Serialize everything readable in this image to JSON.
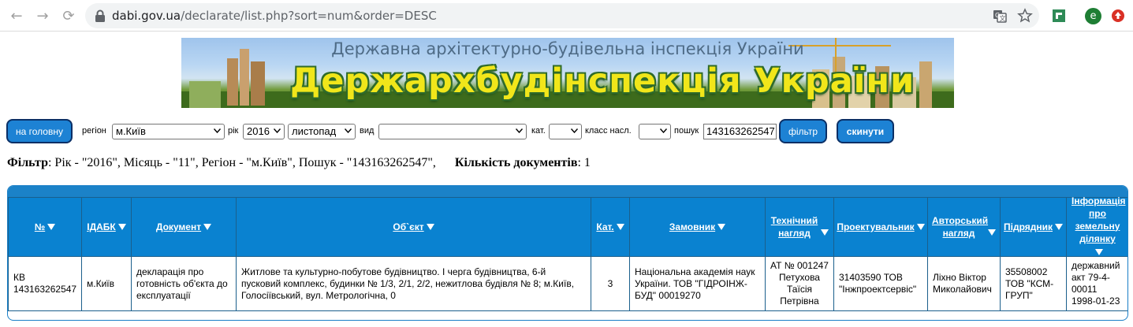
{
  "browser": {
    "url_host": "dabi.gov.ua",
    "url_path": "/declarate/list.php?sort=num&order=DESC",
    "profile_initial": "e"
  },
  "banner": {
    "subtitle": "Державна архітектурно-будівельна інспекція України",
    "title": "Держархбудінспекція України"
  },
  "filters": {
    "home_button": "на головну",
    "region_label": "регіон",
    "region_value": "м.Київ",
    "year_label": "рік",
    "year_value": "2016",
    "month_value": "листопад",
    "type_label": "вид",
    "type_value": "",
    "cat_label": "кат.",
    "cat_value": "",
    "class_label": "класс насл.",
    "class_value": "",
    "search_label": "пошук",
    "search_value": "143163262547",
    "filter_button": "фільтр",
    "reset_button": "скинути"
  },
  "summary": {
    "filter_label": "Фільтр",
    "filter_text": ": Рік - \"2016\", Місяць - \"11\", Регіон - \"м.Київ\", Пошук - \"143163262547\",",
    "count_label": "Кількість документів",
    "count_text": ": 1"
  },
  "table": {
    "headers": [
      "№",
      "ІДАБК",
      "Документ",
      "Об`єкт",
      "Кат.",
      "Замовник",
      "Технічний нагляд",
      "Проектувальник",
      "Авторський нагляд",
      "Підрядник",
      "Інформація про земельну ділянку"
    ],
    "rows": [
      {
        "num": "КВ 143163262547",
        "idabk": "м.Київ",
        "document": "декларація про готовність об'єкта до експлуатації",
        "object": "Житлове та культурно-побутове будівництво. І черга будівництва, 6-й пусковий комплекс, будинки № 1/3, 2/1, 2/2, нежитлова будівля № 8; м.Київ, Голосіївський, вул. Метрологічна, 0",
        "cat": "3",
        "customer": "Національна академія наук України. ТОВ \"ГІДРОІНЖ-БУД\" 00019270",
        "tech_supervision": "АТ № 001247 Петухова Таїсія Петрівна",
        "designer": "31403590 ТОВ \"Інжпроектсервіс\"",
        "author_supervision": "Ліхно Віктор Миколайович",
        "contractor": "35508002 ТОВ \"КСМ-ГРУП\"",
        "land_info": "державний акт 79-4-00011 1998-01-23"
      }
    ]
  }
}
